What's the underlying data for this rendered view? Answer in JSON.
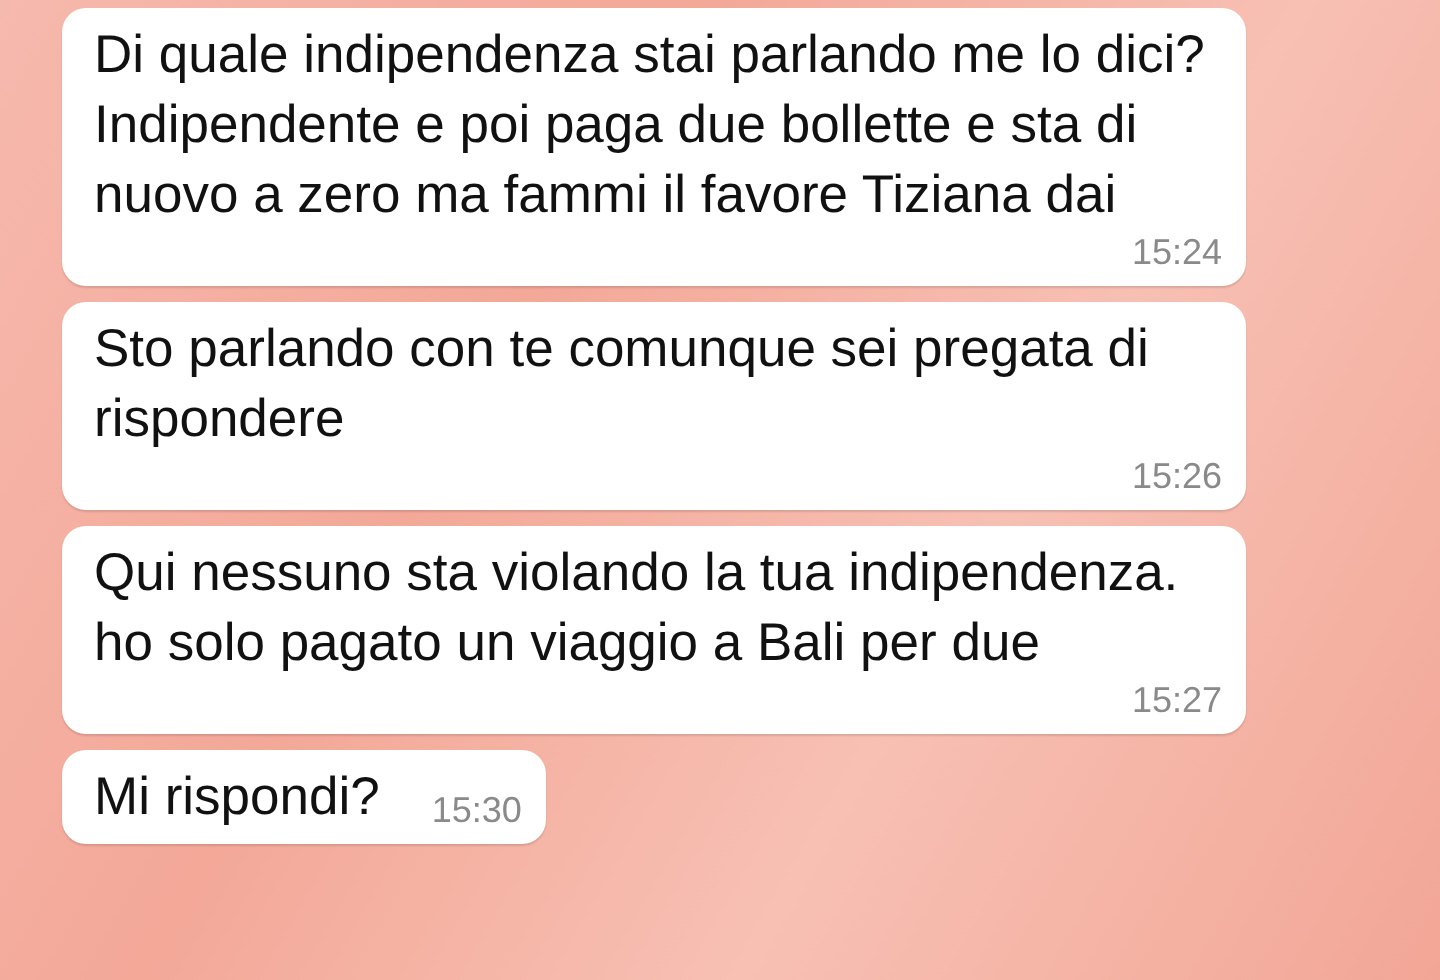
{
  "messages": [
    {
      "text": "Di quale indipendenza stai parlando me lo dici? Indipendente e poi paga due bollette e sta di nuovo a zero ma fammi il favore Tiziana dai",
      "time": "15:24"
    },
    {
      "text": "Sto parlando con te comunque sei pregata di rispondere",
      "time": "15:26"
    },
    {
      "text": "Qui nessuno sta violando la tua indipendenza. ho solo pagato un viaggio a Bali per due",
      "time": "15:27"
    },
    {
      "text": "Mi rispondi?",
      "time": "15:30"
    }
  ]
}
